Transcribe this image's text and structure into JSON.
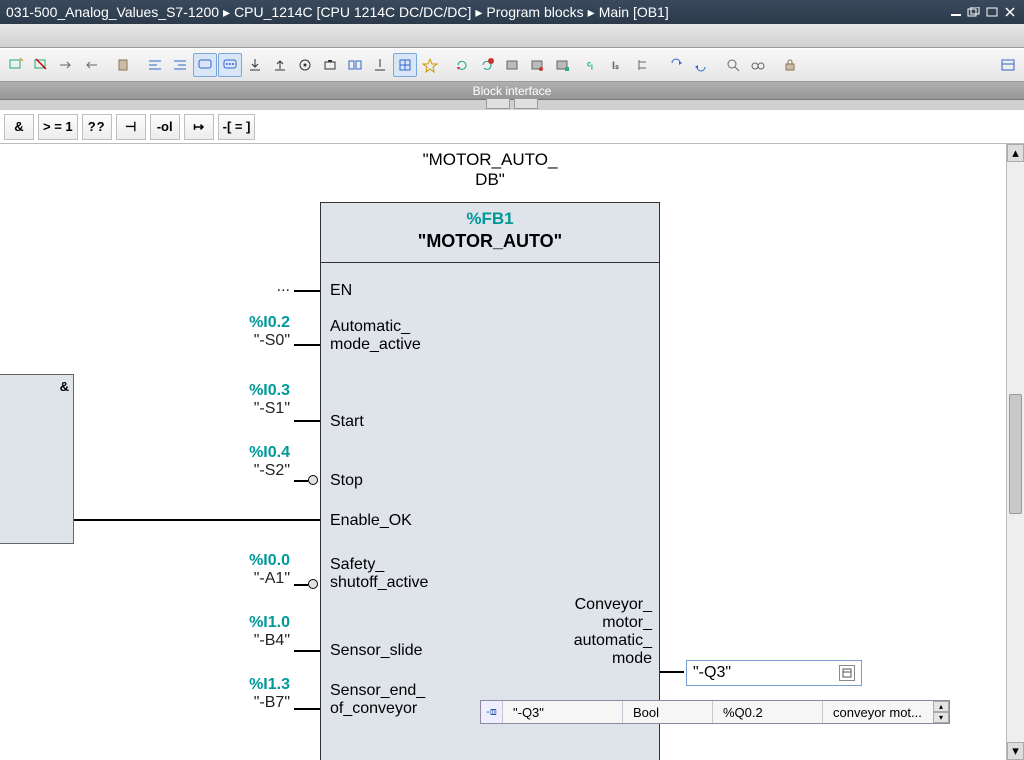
{
  "title": {
    "crumbs": [
      "031-500_Analog_Values_S7-1200",
      "CPU_1214C [CPU 1214C DC/DC/DC]",
      "Program blocks",
      "Main [OB1]"
    ],
    "sep": "  ▸  "
  },
  "block_interface_label": "Block interface",
  "secondbar": {
    "b0": "&",
    "b1": "> = 1",
    "b2": "??",
    "b3": "⊣",
    "b4": "-ol",
    "b5": "↦",
    "b6": "-[ = ]"
  },
  "fb": {
    "db_label": "\"MOTOR_AUTO_\nDB\"",
    "addr": "%FB1",
    "name": "\"MOTOR_AUTO\"",
    "pins_left": {
      "en": "EN",
      "auto": "Automatic_\nmode_active",
      "start": "Start",
      "stop": "Stop",
      "enable": "Enable_OK",
      "safety": "Safety_\nshutoff_active",
      "slide": "Sensor_slide",
      "end": "Sensor_end_\nof_conveyor"
    },
    "pins_right": {
      "out": "Conveyor_\nmotor_\nautomatic_\nmode"
    }
  },
  "signals": {
    "en": {
      "addr": "",
      "tag": "..."
    },
    "auto": {
      "addr": "%I0.2",
      "tag": "\"-S0\""
    },
    "start": {
      "addr": "%I0.3",
      "tag": "\"-S1\""
    },
    "stop": {
      "addr": "%I0.4",
      "tag": "\"-S2\""
    },
    "safety": {
      "addr": "%I0.0",
      "tag": "\"-A1\""
    },
    "slide": {
      "addr": "%I1.0",
      "tag": "\"-B4\""
    },
    "end": {
      "addr": "%I1.3",
      "tag": "\"-B7\""
    }
  },
  "output_edit": {
    "value": "\"-Q3\""
  },
  "tooltip": {
    "name": "\"-Q3\"",
    "type": "Bool",
    "addr": "%Q0.2",
    "comment": "conveyor mot..."
  },
  "leftstub_sym": "&"
}
